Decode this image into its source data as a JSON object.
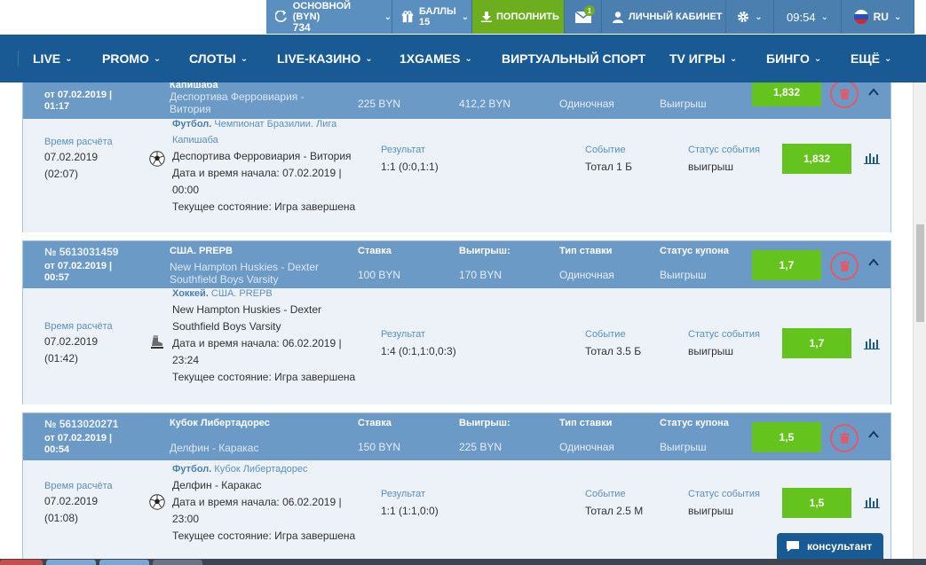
{
  "topbar": {
    "balance_label": "ОСНОВНОЙ (BYN)",
    "balance_value": "734",
    "bonus_label": "БАЛЛЫ",
    "bonus_value": "15",
    "deposit_label": "ПОПОЛНИТЬ",
    "mail_count": "1",
    "cabinet_label": "ЛИЧНЫЙ КАБИНЕТ",
    "time": "09:54",
    "lang": "RU"
  },
  "nav": [
    "LIVE",
    "PROMO",
    "СЛОТЫ",
    "LIVE-КАЗИНО",
    "1XGAMES",
    "ВИРТУАЛЬНЫЙ СПОРТ",
    "TV ИГРЫ",
    "БИНГО",
    "ЕЩЁ"
  ],
  "labels": {
    "stake": "Ставка",
    "win": "Выигрыш:",
    "bet_type": "Тип ставки",
    "coupon_status": "Статус купона",
    "calc_time": "Время расчёта",
    "result": "Результат",
    "event": "Событие",
    "event_status": "Статус события",
    "start_prefix": "Дата и время начала: ",
    "state_prefix": "Текущее состояние: "
  },
  "coupons": [
    {
      "number": "",
      "date_line1": "от 07.02.2019 |",
      "date_line2": "01:17",
      "league": "Капишаба",
      "teams": "Деспортива Ферровиария - Витория",
      "stake": "225 BYN",
      "win": "412,2 BYN",
      "bet_type": "Одиночная",
      "coupon_status": "Выигрыш",
      "coef": "1,832",
      "calc_date": "07.02.2019",
      "calc_time": "(02:07)",
      "sport": "Футбол.",
      "full_league": "Чемпионат Бразилии. Лига Капишаба",
      "event_teams": "Деспортива Ферровиария - Витория",
      "start_date": "07.02.2019 |",
      "start_time": "00:00",
      "state": "Игра завершена",
      "result": "1:1 (0:0,1:1)",
      "event": "Тотал 1 Б",
      "event_status": "выигрыш",
      "event_coef": "1,832"
    },
    {
      "number": "№ 5613031459",
      "date_line1": "от 07.02.2019 |",
      "date_line2": "00:57",
      "league": "США. PREPВ",
      "teams": "New Hampton Huskies - Dexter Southfield Boys Varsity",
      "stake": "100 BYN",
      "win": "170 BYN",
      "bet_type": "Одиночная",
      "coupon_status": "Выигрыш",
      "coef": "1,7",
      "calc_date": "07.02.2019",
      "calc_time": "(01:42)",
      "sport": "Хоккей.",
      "full_league": "США. PREPВ",
      "event_teams": "New Hampton Huskies - Dexter Southfield Boys Varsity",
      "start_date": "06.02.2019 |",
      "start_time": "23:24",
      "state": "Игра завершена",
      "result": "1:4 (0:1,1:0,0:3)",
      "event": "Тотал 3.5 Б",
      "event_status": "выигрыш",
      "event_coef": "1,7"
    },
    {
      "number": "№ 5613020271",
      "date_line1": "от 07.02.2019 |",
      "date_line2": "00:54",
      "league": "Кубок Либертадорес",
      "teams": "Делфин - Каракас",
      "stake": "150 BYN",
      "win": "225 BYN",
      "bet_type": "Одиночная",
      "coupon_status": "Выигрыш",
      "coef": "1,5",
      "calc_date": "07.02.2019",
      "calc_time": "(01:08)",
      "sport": "Футбол.",
      "full_league": "Кубок Либертадорес",
      "event_teams": "Делфин - Каракас",
      "start_date": "06.02.2019 |",
      "start_time": "23:00",
      "state": "Игра завершена",
      "result": "1:1 (1:1,0:0)",
      "event": "Тотал 2.5 М",
      "event_status": "выигрыш",
      "event_coef": "1,5"
    }
  ],
  "consultant": "консультант",
  "colors": {
    "topbar": "#4b7faf",
    "nav": "#1a5a94",
    "coupon_head": "#6c9ac6",
    "coupon_body": "#ecf2f8",
    "green": "#64c31d",
    "trash": "#e05a6a"
  }
}
